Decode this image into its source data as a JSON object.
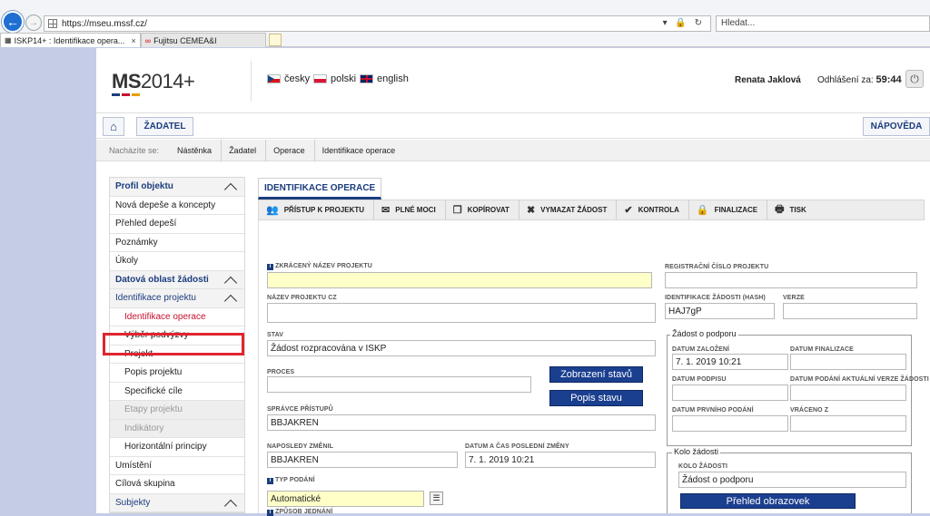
{
  "browser": {
    "url": "https://mseu.mssf.cz/",
    "search_placeholder": "Hledat...",
    "tabs": [
      {
        "label": "ISKP14+ : Identifikace opera..."
      },
      {
        "label": "Fujitsu CEMEA&I"
      }
    ]
  },
  "header": {
    "logo_ms": "MS",
    "logo_rest": "2014+",
    "languages": [
      "česky",
      "polski",
      "english"
    ],
    "user": "Renata Jaklová",
    "logout_label": "Odhlášení za:",
    "logout_time": "59:44"
  },
  "nav": {
    "applicant_label": "ŽADATEL",
    "help_label": "NÁPOVĚDA"
  },
  "breadcrumb": {
    "label": "Nacházíte se:",
    "items": [
      "Nástěnka",
      "Žadatel",
      "Operace",
      "Identifikace operace"
    ]
  },
  "sidebar": {
    "items": [
      {
        "label": "Profil objektu"
      },
      {
        "label": "Nová depeše a koncepty"
      },
      {
        "label": "Přehled depeší"
      },
      {
        "label": "Poznámky"
      },
      {
        "label": "Úkoly"
      },
      {
        "label": "Datová oblast žádosti"
      },
      {
        "label": "Identifikace projektu"
      },
      {
        "label": "Identifikace operace"
      },
      {
        "label": "Výběr podvýzvy"
      },
      {
        "label": "Projekt"
      },
      {
        "label": "Popis projektu"
      },
      {
        "label": "Specifické cíle"
      },
      {
        "label": "Etapy projektu"
      },
      {
        "label": "Indikátory"
      },
      {
        "label": "Horizontální principy"
      },
      {
        "label": "Umístění"
      },
      {
        "label": "Cílová skupina"
      },
      {
        "label": "Subjekty"
      }
    ]
  },
  "main": {
    "tab": "IDENTIFIKACE OPERACE",
    "toolbar": [
      "PŘÍSTUP K PROJEKTU",
      "PLNÉ MOCI",
      "KOPÍROVAT",
      "VYMAZAT ŽÁDOST",
      "KONTROLA",
      "FINALIZACE",
      "TISK"
    ]
  },
  "form": {
    "short_name_label": "ZKRÁCENÝ NÁZEV PROJEKTU",
    "short_name_value": "",
    "reg_no_label": "REGISTRAČNÍ ČÍSLO PROJEKTU",
    "reg_no_value": "",
    "name_cz_label": "NÁZEV PROJEKTU CZ",
    "name_cz_value": "",
    "hash_label": "IDENTIFIKACE ŽÁDOSTI (HASH)",
    "hash_value": "HAJ7gP",
    "version_label": "VERZE",
    "version_value": "",
    "status_label": "STAV",
    "status_value": "Žádost rozpracována v ISKP",
    "process_label": "PROCES",
    "process_value": "",
    "show_states_btn": "Zobrazení stavů",
    "state_desc_btn": "Popis stavu",
    "admin_label": "SPRÁVCE PŘÍSTUPŮ",
    "admin_value": "BBJAKREN",
    "changed_by_label": "NAPOSLEDY ZMĚNIL",
    "changed_by_value": "BBJAKREN",
    "changed_at_label": "DATUM A ČAS POSLEDNÍ ZMĚNY",
    "changed_at_value": "7. 1. 2019 10:21",
    "submit_type_label": "TYP PODÁNÍ",
    "submit_type_value": "Automatické",
    "negotiation_label": "ZPŮSOB JEDNÁNÍ",
    "support_group": {
      "title": "Žádost o podporu",
      "created_label": "DATUM ZALOŽENÍ",
      "created_value": "7. 1. 2019 10:21",
      "final_label": "DATUM FINALIZACE",
      "final_value": "",
      "sign_label": "DATUM PODPISU",
      "sign_value": "",
      "submit_current_label": "DATUM PODÁNÍ AKTUÁLNÍ VERZE ŽÁDOSTI",
      "submit_current_value": "",
      "first_submit_label": "DATUM PRVNÍHO PODÁNÍ",
      "first_submit_value": "",
      "returned_label": "VRÁCENO Z",
      "returned_value": ""
    },
    "round_group": {
      "title": "Kolo žádosti",
      "round_label": "KOLO ŽÁDOSTI",
      "round_value": "Žádost o podporu",
      "screens_btn": "Přehled obrazovek"
    }
  }
}
